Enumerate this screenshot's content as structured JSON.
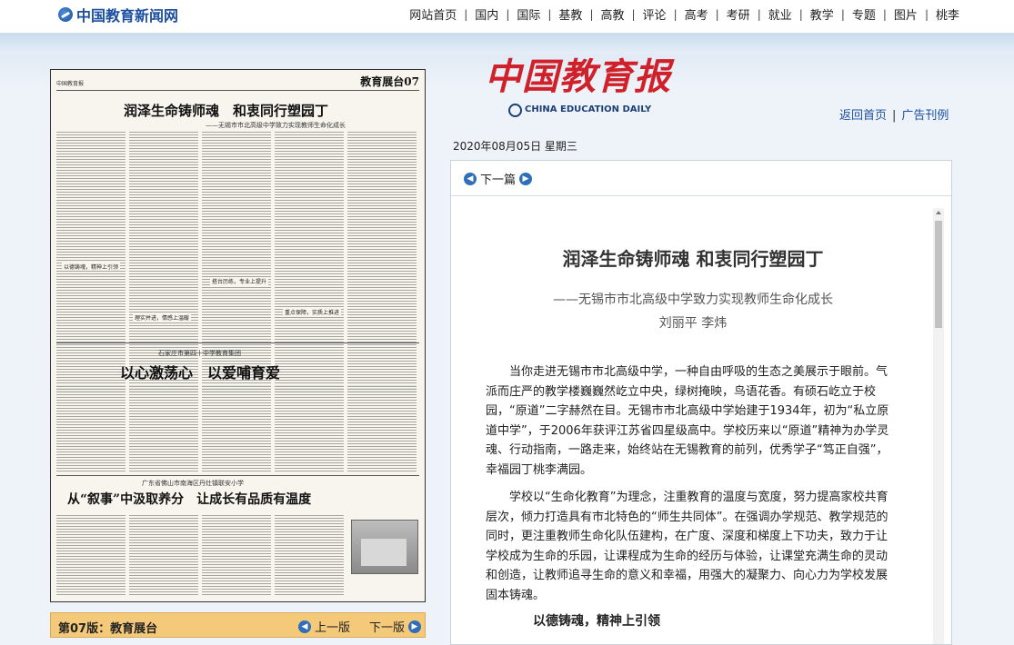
{
  "site": {
    "logo_text": "中国教育新闻网",
    "nav": [
      "网站首页",
      "国内",
      "国际",
      "基教",
      "高教",
      "评论",
      "高考",
      "考研",
      "就业",
      "教学",
      "专题",
      "图片",
      "桃李"
    ]
  },
  "masthead": {
    "title_cn": "中国教育报",
    "title_en": "CHINA EDUCATION DAILY",
    "links": [
      "返回首页",
      "广告刊例"
    ],
    "date": "2020年08月05日  星期三"
  },
  "newspaper_page": {
    "edition_label": "教育展台07",
    "paper_name": "中国教育报",
    "headline": "润泽生命铸师魂　和衷同行塑园丁",
    "subheadline": "——无锡市市北高级中学致力实现教师生命化成长",
    "story2_kicker": "石家庄市第四十中学教育集团",
    "story2_headline": "以心激荡心　以爱哺育爱",
    "story3_kicker": "广东省佛山市南海区丹灶镇联安小学",
    "story3_headline": "从“叙事”中汲取养分　让成长有品质有温度",
    "section_labels": [
      "以德铸魂，精神上引领",
      "搭台历练，专业上提升",
      "理实并进，情感上温暖",
      "重点保障，实质上推进"
    ]
  },
  "page_bar": {
    "page_name": "第07版：教育展台",
    "prev_label": "上一版",
    "next_label": "下一版"
  },
  "article": {
    "next_label": "下一篇",
    "title": "润泽生命铸师魂  和衷同行塑园丁",
    "subtitle": "——无锡市市北高级中学致力实现教师生命化成长",
    "author": "刘丽平  李炜",
    "paragraphs": [
      "当你走进无锡市市北高级中学，一种自由呼吸的生态之美展示于眼前。气派而庄严的教学楼巍巍然屹立中央，绿树掩映，鸟语花香。有硕石屹立于校园，“原道”二字赫然在目。无锡市市北高级中学始建于1934年，初为“私立原道中学”，于2006年获评江苏省四星级高中。学校历来以“原道”精神为办学灵魂、行动指南，一路走来，始终站在无锡教育的前列，优秀学子“笃正自强”，幸福园丁桃李满园。",
      "学校以“生命化教育”为理念，注重教育的温度与宽度，努力提高家校共育层次，倾力打造具有市北特色的“师生共同体”。在强调办学规范、教学规范的同时，更注重教师生命化队伍建构，在广度、深度和梯度上下功夫，致力于让学校成为生命的乐园，让课程成为生命的经历与体验，让课堂充满生命的灵动和创造，让教师追寻生命的意义和幸福，用强大的凝聚力、向心力为学校发展固本铸魂。"
    ],
    "section_heading": "以德铸魂，精神上引领"
  }
}
